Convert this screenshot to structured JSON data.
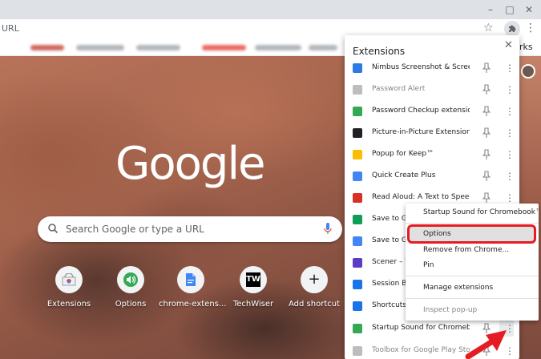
{
  "toolbar": {
    "omnibox_text": "URL",
    "bookmarks_right_text": "rks"
  },
  "window_controls": {
    "minimize": "–",
    "maximize": "□",
    "close": "✕"
  },
  "ntp": {
    "logo": "Google",
    "search_placeholder": "Search Google or type a URL",
    "shortcuts": [
      {
        "label": "Extensions",
        "icon": "chrome-webstore-icon"
      },
      {
        "label": "Options",
        "icon": "speaker-icon"
      },
      {
        "label": "chrome-extens...",
        "icon": "document-icon"
      },
      {
        "label": "TechWiser",
        "icon": "techwiser-logo",
        "text": "TW"
      },
      {
        "label": "Add shortcut",
        "icon": "plus-icon",
        "text": "+"
      }
    ]
  },
  "extensions_panel": {
    "title": "Extensions",
    "close": "✕",
    "items": [
      {
        "name": "Nimbus Screenshot & Screen V...",
        "icon_color": "#2c7be5"
      },
      {
        "name": "Password Alert",
        "icon_color": "#bdbdbd",
        "disabled": true
      },
      {
        "name": "Password Checkup extension",
        "icon_color": "#34a853"
      },
      {
        "name": "Picture-in-Picture Extension (by...",
        "icon_color": "#202124"
      },
      {
        "name": "Popup for Keep™",
        "icon_color": "#fbbc04"
      },
      {
        "name": "Quick Create Plus",
        "icon_color": "#4285f4"
      },
      {
        "name": "Read Aloud: A Text to Speech V...",
        "icon_color": "#d93025"
      },
      {
        "name": "Save to Goo...",
        "icon_color": "#0f9d58"
      },
      {
        "name": "Save to Goo...",
        "icon_color": "#4285f4"
      },
      {
        "name": "Scener – Vi...",
        "icon_color": "#5b3cc4"
      },
      {
        "name": "Session Bud...",
        "icon_color": "#1a73e8"
      },
      {
        "name": "Shortcuts fo...",
        "icon_color": "#1a73e8"
      },
      {
        "name": "Startup Sound for Chromeboo...",
        "icon_color": "#34a853"
      },
      {
        "name": "Toolbox for Google Play Store™",
        "icon_color": "#bdbdbd",
        "disabled": true
      }
    ]
  },
  "context_menu": {
    "items": [
      {
        "label": "Startup Sound for Chromebook™"
      },
      {
        "label": "Options",
        "highlighted": true
      },
      {
        "label": "Remove from Chrome..."
      },
      {
        "label": "Pin"
      },
      {
        "label": "Manage extensions"
      },
      {
        "label": "Inspect pop-up",
        "disabled": true
      }
    ]
  },
  "colors": {
    "annotation_red": "#e51c23",
    "titlebar": "#dee1e6"
  }
}
